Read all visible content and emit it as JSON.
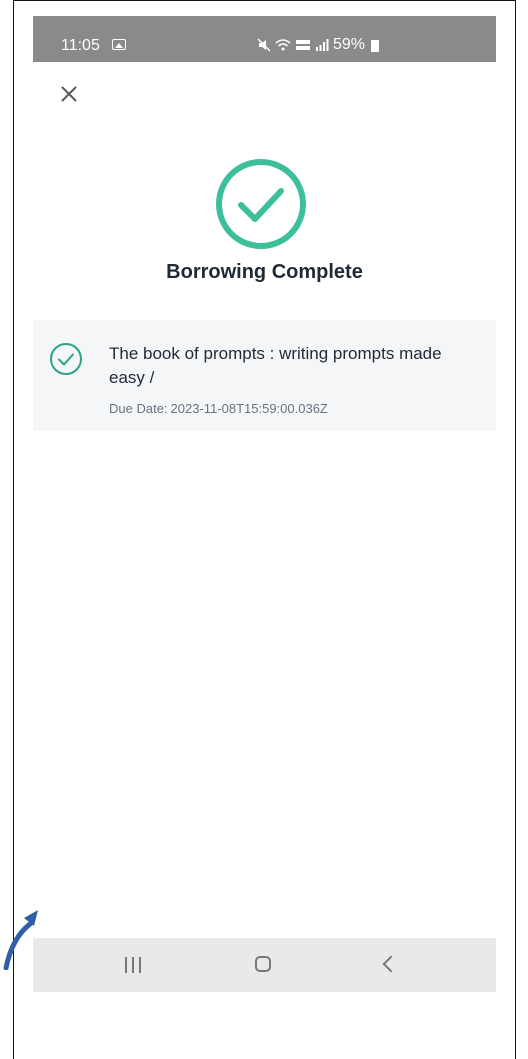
{
  "status_bar": {
    "time": "11:05",
    "battery": "59%"
  },
  "screen": {
    "title": "Borrowing Complete",
    "close_icon": "close-icon",
    "success_icon": "check-circle-icon"
  },
  "borrowed_items": [
    {
      "title": "The book of prompts : writing prompts made easy /",
      "due_label": "Due Date:",
      "due_date": "2023-11-08T15:59:00.036Z"
    }
  ],
  "nav_bar": {
    "recent": "recent-apps-icon",
    "home": "home-icon",
    "back": "back-icon"
  },
  "colors": {
    "accent": "#3dbf9c",
    "item_check": "#2aa580",
    "title_text": "#1f2a37",
    "card_bg": "#f4f6f8",
    "status_bg": "#8a8a8a",
    "annotation_arrow": "#2f5fa7"
  }
}
